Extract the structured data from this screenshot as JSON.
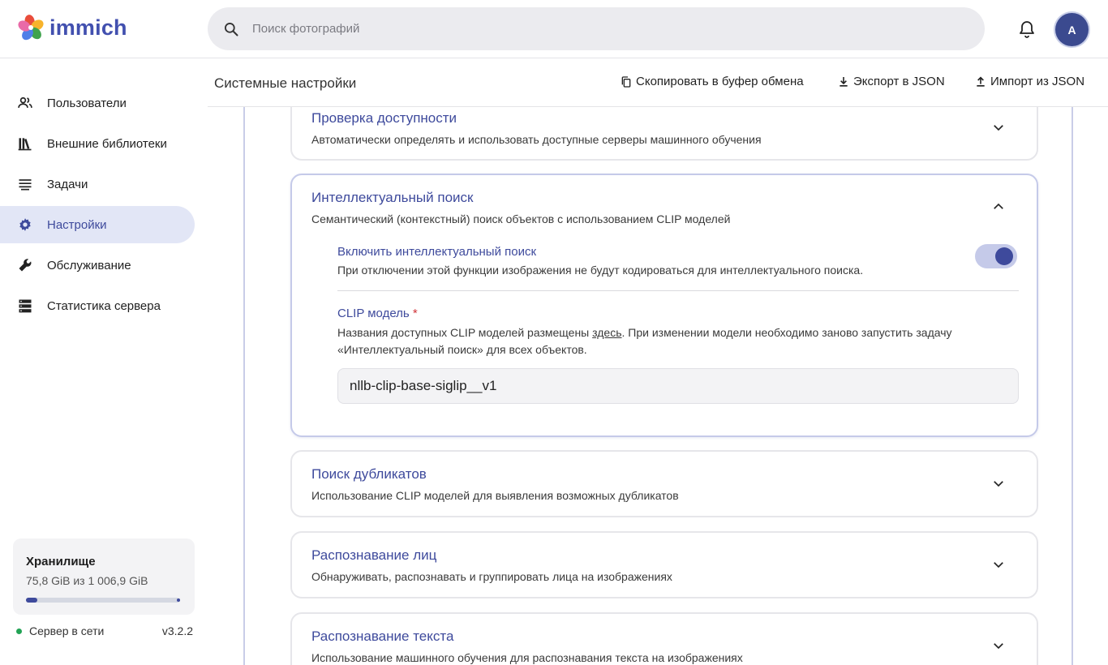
{
  "app": {
    "name": "immich",
    "logo_colors": [
      "#e94d3b",
      "#f7b32b",
      "#3fa34d",
      "#4f7fe8",
      "#9b59d0",
      "#e96aa8"
    ]
  },
  "search": {
    "placeholder": "Поиск фотографий",
    "value": ""
  },
  "user": {
    "avatar_initial": "A"
  },
  "sidebar": {
    "items": [
      {
        "label": "Пользователи",
        "icon": "users-icon",
        "active": false
      },
      {
        "label": "Внешние библиотеки",
        "icon": "library-icon",
        "active": false
      },
      {
        "label": "Задачи",
        "icon": "jobs-icon",
        "active": false
      },
      {
        "label": "Настройки",
        "icon": "gear-icon",
        "active": true
      },
      {
        "label": "Обслуживание",
        "icon": "wrench-icon",
        "active": false
      },
      {
        "label": "Статистика сервера",
        "icon": "server-icon",
        "active": false
      }
    ],
    "storage": {
      "title": "Хранилище",
      "usage": "75,8 GiB из 1 006,9 GiB",
      "used_fraction": 0.075
    },
    "server": {
      "status": "Сервер в сети",
      "version": "v3.2.2",
      "status_color": "#22a355"
    }
  },
  "header": {
    "title": "Системные настройки",
    "copy_label": "Скопировать в буфер обмена",
    "export_label": "Экспорт в JSON",
    "import_label": "Импорт из JSON"
  },
  "cards": {
    "availability": {
      "title": "Проверка доступности",
      "description": "Автоматически определять и использовать доступные серверы машинного обучения"
    },
    "smart_search": {
      "title": "Интеллектуальный поиск",
      "description": "Семантический (контекстный) поиск объектов с использованием CLIP моделей",
      "enable_title": "Включить интеллектуальный поиск",
      "enable_desc": "При отключении этой функции изображения не будут кодироваться для интеллектуального поиска.",
      "enabled": true,
      "model_label": "CLIP модель",
      "model_required": "*",
      "model_desc_before": "Названия доступных CLIP моделей размещены ",
      "model_desc_link": "здесь",
      "model_desc_after": ". При изменении модели необходимо заново запустить задачу «Интеллектуальный поиск» для всех объектов.",
      "model_value": "nllb-clip-base-siglip__v1"
    },
    "duplicates": {
      "title": "Поиск дубликатов",
      "description": "Использование CLIP моделей для выявления возможных дубликатов"
    },
    "faces": {
      "title": "Распознавание лиц",
      "description": "Обнаруживать, распознавать и группировать лица на изображениях"
    },
    "ocr": {
      "title": "Распознавание текста",
      "description": "Использование машинного обучения для распознавания текста на изображениях"
    }
  },
  "colors": {
    "accent": "#3e4a9c",
    "accent_light": "#e2e6f6",
    "toggle_track": "#c5cae9"
  }
}
